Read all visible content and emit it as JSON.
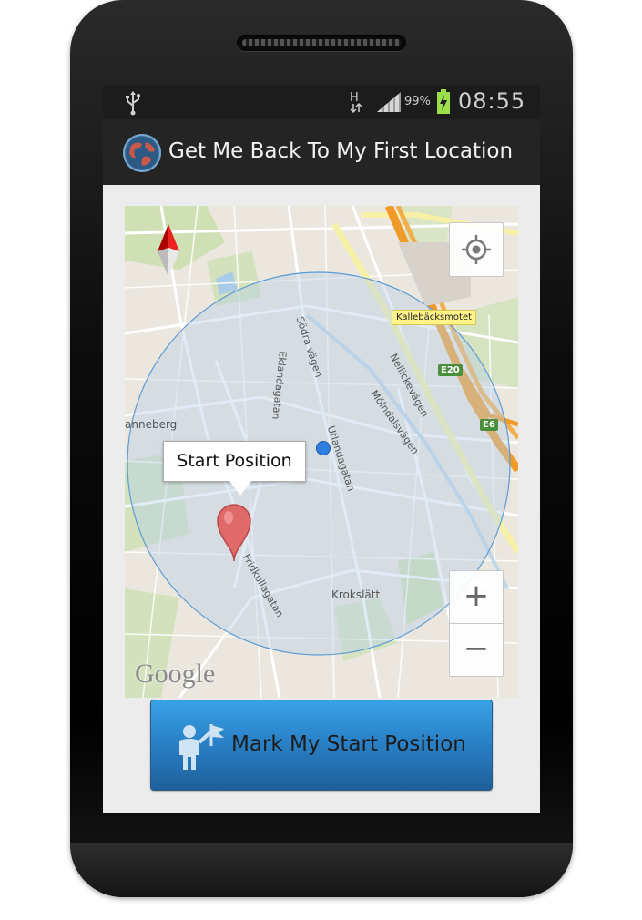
{
  "status_bar": {
    "usb_icon": "usb-icon",
    "network_type": "H",
    "battery_percent": "99%",
    "time": "08:55"
  },
  "action_bar": {
    "app_icon": "globe-icon",
    "title": "Get Me Back To My First Location"
  },
  "map": {
    "labels": {
      "place_badge": "Kallebäcksmotet",
      "road_e20": "E20",
      "road_e6": "E6",
      "street_sodra": "Södra vägen",
      "street_eklanda": "Eklandagatan",
      "street_nellicke": "Nellickevägen",
      "street_molndals": "Mölndalsvägen",
      "street_utlanda": "Utlandagatan",
      "street_fridkulla": "Fridkullagatan",
      "area_krokslatt": "Krokslätt",
      "area_johanneberg": "anneberg"
    },
    "info_window": "Start Position",
    "attribution": "Google",
    "controls": {
      "zoom_in": "+",
      "zoom_out": "−"
    },
    "colors": {
      "circle_fill": "#b8d0e8",
      "circle_stroke": "#5b9bd5",
      "marker": "#e06a6a",
      "highway": "#f09a2a"
    }
  },
  "button": {
    "label": "Mark My Start Position",
    "icon": "flag-person-icon",
    "color": "#2a82c8"
  }
}
